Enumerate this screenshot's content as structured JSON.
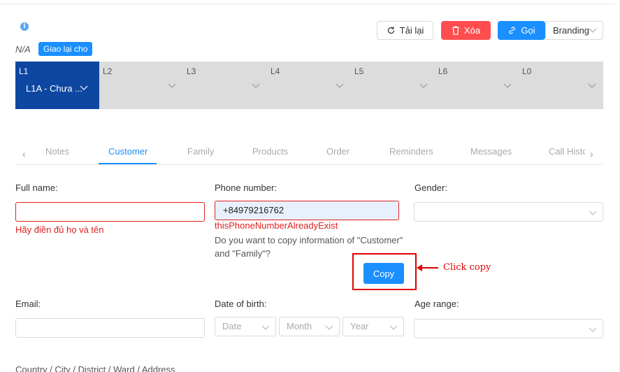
{
  "header": {
    "info_icon": "info-icon",
    "na_text": "N/A",
    "assign_label": "Giao lại cho",
    "reload_label": "Tải lại",
    "delete_label": "Xóa",
    "call_label": "Gọi",
    "branding_value": "Branding",
    "colors": {
      "primary": "#1a8fff",
      "danger": "#ff4d4f",
      "stage_active": "#0d47a1"
    }
  },
  "stages": [
    {
      "label": "L1",
      "value": "L1A - Chưa ..."
    },
    {
      "label": "L2",
      "value": ""
    },
    {
      "label": "L3",
      "value": ""
    },
    {
      "label": "L4",
      "value": ""
    },
    {
      "label": "L5",
      "value": ""
    },
    {
      "label": "L6",
      "value": ""
    },
    {
      "label": "L0",
      "value": ""
    }
  ],
  "tabs": [
    "Notes",
    "Customer",
    "Family",
    "Products",
    "Order",
    "Reminders",
    "Messages",
    "Call Histc"
  ],
  "active_tab": "Customer",
  "form": {
    "full_name_label": "Full name:",
    "full_name_value": "",
    "full_name_error": "Hãy điền đủ họ và tên",
    "phone_label": "Phone number:",
    "phone_value": "+84979216762",
    "phone_error": "thisPhoneNumberAlreadyExist",
    "copy_question": "Do you want to copy information of \"Customer\" and \"Family\"?",
    "copy_label": "Copy",
    "gender_label": "Gender:",
    "email_label": "Email:",
    "dob_label": "Date of birth:",
    "dob_date_placeholder": "Date",
    "dob_month_placeholder": "Month",
    "dob_year_placeholder": "Year",
    "age_range_label": "Age range:",
    "address_label": "Country / City / District / Ward / Address"
  },
  "annotation": {
    "text": "Click copy"
  }
}
